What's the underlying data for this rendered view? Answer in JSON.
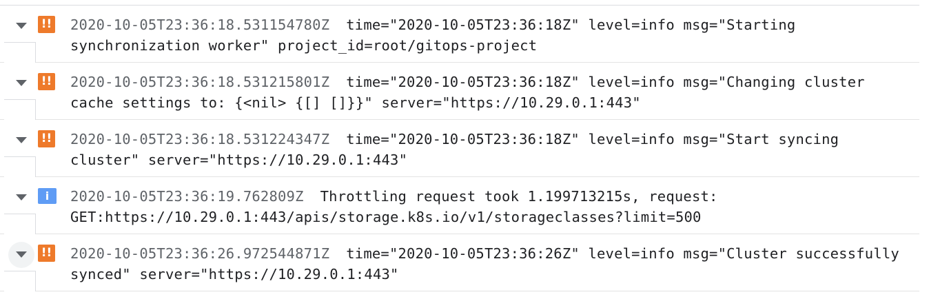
{
  "colors": {
    "warning": "#ee7a2b",
    "info": "#5f9cf5",
    "timestamp": "#5f6368",
    "text": "#202124",
    "divider": "#e3e3e3"
  },
  "icons": {
    "expand": "chevron-down-icon",
    "warning_severity": "warning-severity-icon",
    "info_severity": "info-severity-icon"
  },
  "log": {
    "entries": [
      {
        "severity": "warning",
        "severity_glyph": "!!",
        "timestamp": "2020-10-05T23:36:18.531154780Z",
        "message": "time=\"2020-10-05T23:36:18Z\" level=info msg=\"Starting synchronization worker\" project_id=root/gitops-project"
      },
      {
        "severity": "warning",
        "severity_glyph": "!!",
        "timestamp": "2020-10-05T23:36:18.531215801Z",
        "message": "time=\"2020-10-05T23:36:18Z\" level=info msg=\"Changing cluster cache settings to: {<nil> {[] []}}\" server=\"https://10.29.0.1:443\""
      },
      {
        "severity": "warning",
        "severity_glyph": "!!",
        "timestamp": "2020-10-05T23:36:18.531224347Z",
        "message": "time=\"2020-10-05T23:36:18Z\" level=info msg=\"Start syncing cluster\" server=\"https://10.29.0.1:443\""
      },
      {
        "severity": "info",
        "severity_glyph": "i",
        "timestamp": "2020-10-05T23:36:19.762809Z",
        "message": "Throttling request took 1.199713215s, request: GET:https://10.29.0.1:443/apis/storage.k8s.io/v1/storageclasses?limit=500"
      },
      {
        "severity": "warning",
        "severity_glyph": "!!",
        "timestamp": "2020-10-05T23:36:26.972544871Z",
        "message": "time=\"2020-10-05T23:36:26Z\" level=info msg=\"Cluster successfully synced\" server=\"https://10.29.0.1:443\""
      }
    ]
  }
}
